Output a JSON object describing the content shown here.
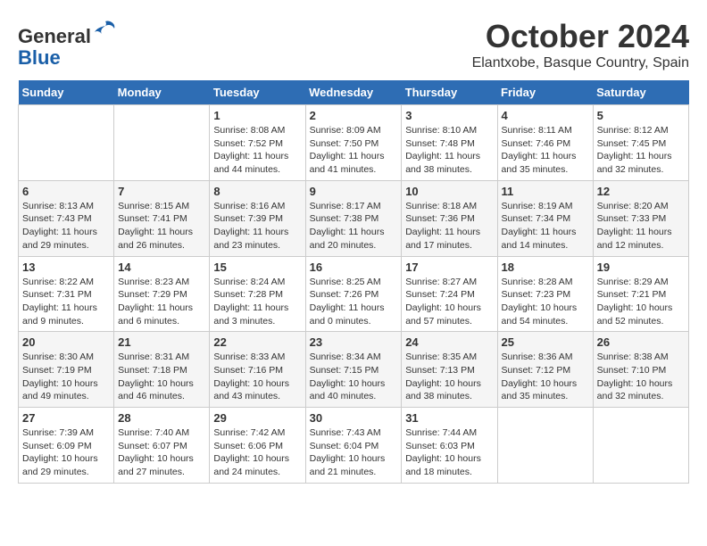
{
  "header": {
    "logo_line1": "General",
    "logo_line2": "Blue",
    "month_title": "October 2024",
    "location": "Elantxobe, Basque Country, Spain"
  },
  "days_of_week": [
    "Sunday",
    "Monday",
    "Tuesday",
    "Wednesday",
    "Thursday",
    "Friday",
    "Saturday"
  ],
  "weeks": [
    [
      {
        "day": "",
        "info": ""
      },
      {
        "day": "",
        "info": ""
      },
      {
        "day": "1",
        "info": "Sunrise: 8:08 AM\nSunset: 7:52 PM\nDaylight: 11 hours and 44 minutes."
      },
      {
        "day": "2",
        "info": "Sunrise: 8:09 AM\nSunset: 7:50 PM\nDaylight: 11 hours and 41 minutes."
      },
      {
        "day": "3",
        "info": "Sunrise: 8:10 AM\nSunset: 7:48 PM\nDaylight: 11 hours and 38 minutes."
      },
      {
        "day": "4",
        "info": "Sunrise: 8:11 AM\nSunset: 7:46 PM\nDaylight: 11 hours and 35 minutes."
      },
      {
        "day": "5",
        "info": "Sunrise: 8:12 AM\nSunset: 7:45 PM\nDaylight: 11 hours and 32 minutes."
      }
    ],
    [
      {
        "day": "6",
        "info": "Sunrise: 8:13 AM\nSunset: 7:43 PM\nDaylight: 11 hours and 29 minutes."
      },
      {
        "day": "7",
        "info": "Sunrise: 8:15 AM\nSunset: 7:41 PM\nDaylight: 11 hours and 26 minutes."
      },
      {
        "day": "8",
        "info": "Sunrise: 8:16 AM\nSunset: 7:39 PM\nDaylight: 11 hours and 23 minutes."
      },
      {
        "day": "9",
        "info": "Sunrise: 8:17 AM\nSunset: 7:38 PM\nDaylight: 11 hours and 20 minutes."
      },
      {
        "day": "10",
        "info": "Sunrise: 8:18 AM\nSunset: 7:36 PM\nDaylight: 11 hours and 17 minutes."
      },
      {
        "day": "11",
        "info": "Sunrise: 8:19 AM\nSunset: 7:34 PM\nDaylight: 11 hours and 14 minutes."
      },
      {
        "day": "12",
        "info": "Sunrise: 8:20 AM\nSunset: 7:33 PM\nDaylight: 11 hours and 12 minutes."
      }
    ],
    [
      {
        "day": "13",
        "info": "Sunrise: 8:22 AM\nSunset: 7:31 PM\nDaylight: 11 hours and 9 minutes."
      },
      {
        "day": "14",
        "info": "Sunrise: 8:23 AM\nSunset: 7:29 PM\nDaylight: 11 hours and 6 minutes."
      },
      {
        "day": "15",
        "info": "Sunrise: 8:24 AM\nSunset: 7:28 PM\nDaylight: 11 hours and 3 minutes."
      },
      {
        "day": "16",
        "info": "Sunrise: 8:25 AM\nSunset: 7:26 PM\nDaylight: 11 hours and 0 minutes."
      },
      {
        "day": "17",
        "info": "Sunrise: 8:27 AM\nSunset: 7:24 PM\nDaylight: 10 hours and 57 minutes."
      },
      {
        "day": "18",
        "info": "Sunrise: 8:28 AM\nSunset: 7:23 PM\nDaylight: 10 hours and 54 minutes."
      },
      {
        "day": "19",
        "info": "Sunrise: 8:29 AM\nSunset: 7:21 PM\nDaylight: 10 hours and 52 minutes."
      }
    ],
    [
      {
        "day": "20",
        "info": "Sunrise: 8:30 AM\nSunset: 7:19 PM\nDaylight: 10 hours and 49 minutes."
      },
      {
        "day": "21",
        "info": "Sunrise: 8:31 AM\nSunset: 7:18 PM\nDaylight: 10 hours and 46 minutes."
      },
      {
        "day": "22",
        "info": "Sunrise: 8:33 AM\nSunset: 7:16 PM\nDaylight: 10 hours and 43 minutes."
      },
      {
        "day": "23",
        "info": "Sunrise: 8:34 AM\nSunset: 7:15 PM\nDaylight: 10 hours and 40 minutes."
      },
      {
        "day": "24",
        "info": "Sunrise: 8:35 AM\nSunset: 7:13 PM\nDaylight: 10 hours and 38 minutes."
      },
      {
        "day": "25",
        "info": "Sunrise: 8:36 AM\nSunset: 7:12 PM\nDaylight: 10 hours and 35 minutes."
      },
      {
        "day": "26",
        "info": "Sunrise: 8:38 AM\nSunset: 7:10 PM\nDaylight: 10 hours and 32 minutes."
      }
    ],
    [
      {
        "day": "27",
        "info": "Sunrise: 7:39 AM\nSunset: 6:09 PM\nDaylight: 10 hours and 29 minutes."
      },
      {
        "day": "28",
        "info": "Sunrise: 7:40 AM\nSunset: 6:07 PM\nDaylight: 10 hours and 27 minutes."
      },
      {
        "day": "29",
        "info": "Sunrise: 7:42 AM\nSunset: 6:06 PM\nDaylight: 10 hours and 24 minutes."
      },
      {
        "day": "30",
        "info": "Sunrise: 7:43 AM\nSunset: 6:04 PM\nDaylight: 10 hours and 21 minutes."
      },
      {
        "day": "31",
        "info": "Sunrise: 7:44 AM\nSunset: 6:03 PM\nDaylight: 10 hours and 18 minutes."
      },
      {
        "day": "",
        "info": ""
      },
      {
        "day": "",
        "info": ""
      }
    ]
  ]
}
